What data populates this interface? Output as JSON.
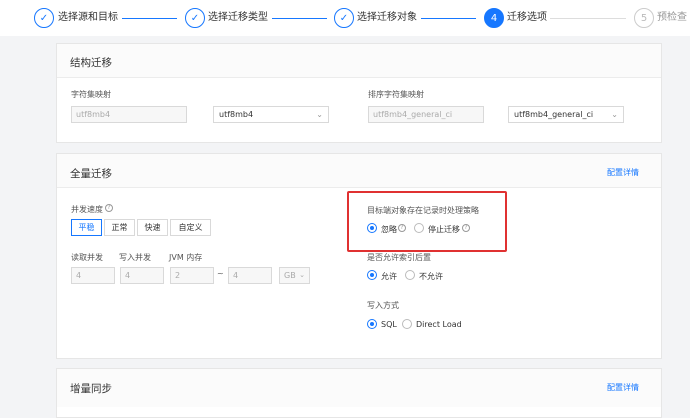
{
  "steps": [
    {
      "label": "选择源和目标",
      "status": "done"
    },
    {
      "label": "选择迁移类型",
      "status": "done"
    },
    {
      "label": "选择迁移对象",
      "status": "done"
    },
    {
      "label": "迁移选项",
      "status": "active",
      "number": "4"
    },
    {
      "label": "预检查",
      "status": "todo",
      "number": "5"
    }
  ],
  "structure": {
    "title": "结构迁移",
    "charset_label": "字符集映射",
    "charset_source": "utf8mb4",
    "charset_target": "utf8mb4",
    "collation_label": "排序字符集映射",
    "collation_source": "utf8mb4_general_ci",
    "collation_target": "utf8mb4_general_ci"
  },
  "full": {
    "title": "全量迁移",
    "config_link": "配置详情",
    "speed_label": "并发速度",
    "speed_options": [
      "平稳",
      "正常",
      "快速",
      "自定义"
    ],
    "speed_selected": "平稳",
    "read_label": "读取并发",
    "write_label": "写入并发",
    "jvm_label": "JVM 内存",
    "read_value": "4",
    "write_value": "4",
    "jvm_min": "2",
    "jvm_sep": "~",
    "jvm_max": "4",
    "jvm_unit": "GB",
    "record_policy_label": "目标端对象存在记录时处理策略",
    "record_policy_options": [
      "忽略",
      "停止迁移"
    ],
    "record_policy_selected": "忽略",
    "index_label": "是否允许索引后置",
    "index_options": [
      "允许",
      "不允许"
    ],
    "index_selected": "允许",
    "write_mode_label": "写入方式",
    "write_mode_options": [
      "SQL",
      "Direct Load"
    ],
    "write_mode_selected": "SQL"
  },
  "incremental": {
    "title": "增量同步",
    "config_link": "配置详情"
  },
  "colors": {
    "accent": "#1677ff",
    "highlight": "#e03131"
  }
}
